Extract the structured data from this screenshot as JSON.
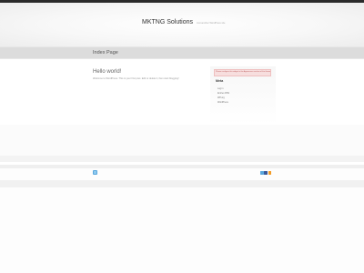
{
  "header": {
    "site_title": "MKTNG Solutions",
    "tagline": "Just another WordPress site"
  },
  "page": {
    "title": "Index Page"
  },
  "post": {
    "title": "Hello world!",
    "body": "Welcome to WordPress. This is your first post. Edit or delete it, then start blogging!"
  },
  "sidebar": {
    "notice": "Please configure this widget in the Appearance section of the theme options.",
    "meta_title": "Meta",
    "meta_items": [
      {
        "label": "Log in"
      },
      {
        "label": "Entries RSS"
      },
      {
        "label": "WP.org"
      },
      {
        "label": "WordPress"
      }
    ]
  },
  "footer": {
    "icons": [
      "twitter-icon",
      "facebook-icon",
      "rss-icon"
    ],
    "colors": {
      "twitter": "#5aa7dd",
      "facebook": "#3b5998",
      "rss": "#f39c27"
    }
  }
}
